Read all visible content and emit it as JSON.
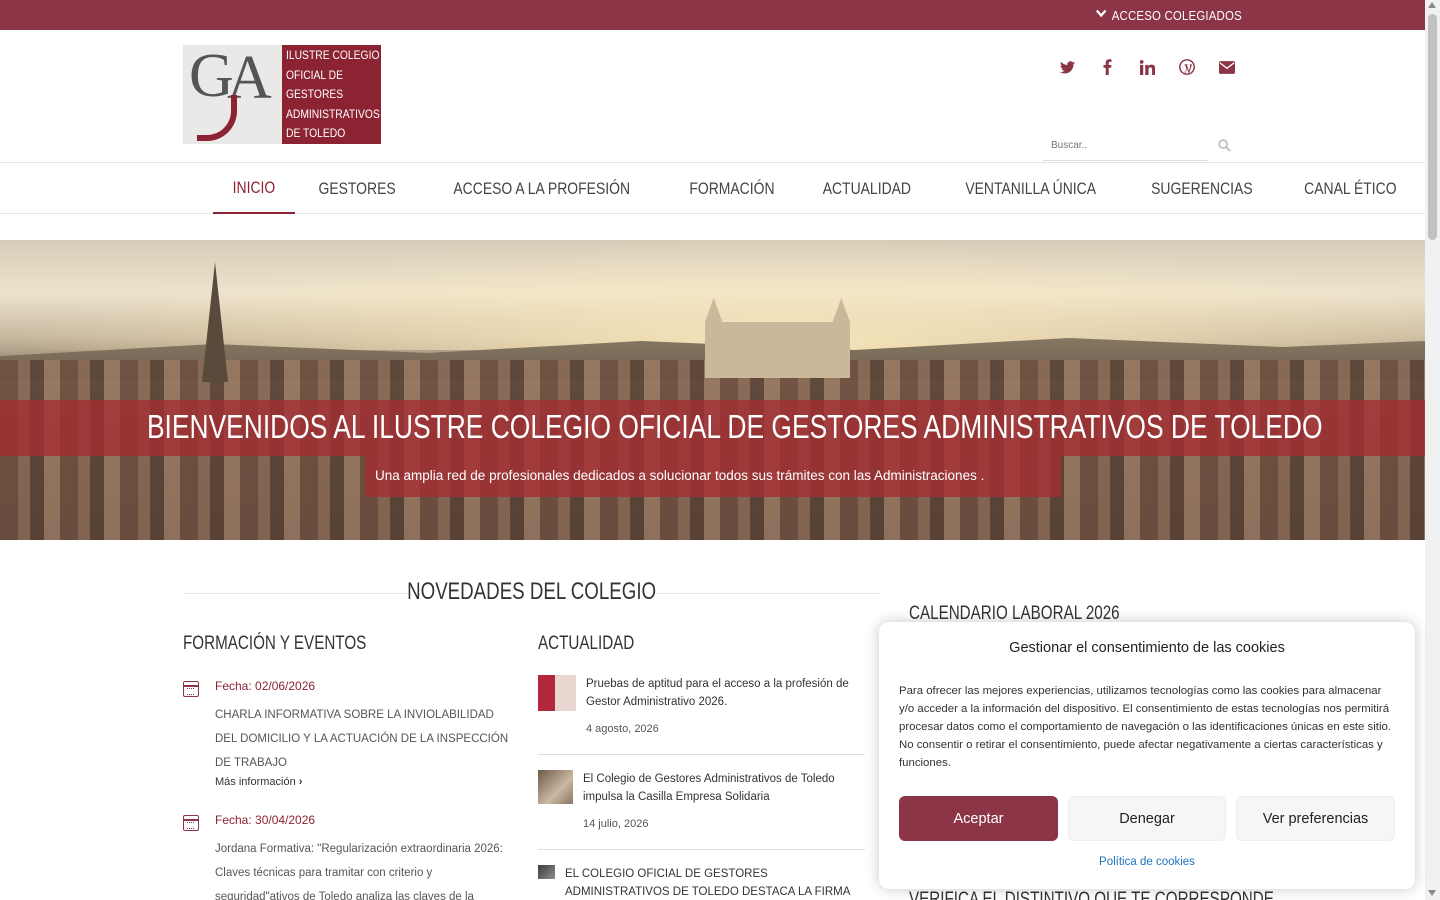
{
  "topbar": {
    "access_label": "ACCESO COLEGIADOS",
    "access_icon": "chevron-down-icon",
    "color": "#8b3547"
  },
  "logo": {
    "initials": "GA",
    "lines": [
      "ILUSTRE COLEGIO",
      "OFICIAL DE",
      "GESTORES",
      "ADMINISTRATIVOS",
      "DE TOLEDO"
    ],
    "color": "#8b2332"
  },
  "social": [
    "twitter-icon",
    "facebook-icon",
    "linkedin-icon",
    "wordpress-icon",
    "envelope-icon"
  ],
  "search": {
    "placeholder": "Buscar..",
    "icon": "search-icon"
  },
  "nav": {
    "items": [
      "INICIO",
      "GESTORES",
      "ACCESO A LA PROFESIÓN",
      "FORMACIÓN",
      "ACTUALIDAD",
      "VENTANILLA ÚNICA",
      "SUGERENCIAS",
      "CANAL ÉTICO"
    ],
    "active": "INICIO"
  },
  "hero": {
    "title": "BIENVENIDOS AL ILUSTRE COLEGIO OFICIAL DE GESTORES ADMINISTRATIVOS DE TOLEDO",
    "subtitle": "Una amplia red de profesionales dedicados a solucionar todos sus trámites con las Administraciones ."
  },
  "main": {
    "section_title": "NOVEDADES DEL COLEGIO",
    "events_heading": "FORMACIÓN Y EVENTOS",
    "events": [
      {
        "date": "Fecha: 02/06/2026",
        "body": "CHARLA INFORMATIVA SOBRE LA INVIOLABILIDAD DEL DOMICILIO Y LA ACTUACIÓN DE LA INSPECCIÓN DE TRABAJO",
        "more": "Más información"
      },
      {
        "date": "Fecha: 30/04/2026",
        "body": "Jordana Formativa: \"Regularización extraordinaria 2026: Claves técnicas para tramitar con criterio y seguridad\"ativos de Toledo analiza las claves de la",
        "more": ""
      }
    ],
    "news_heading": "ACTUALIDAD",
    "news": [
      {
        "title": "Pruebas de aptitud para el acceso a la profesión de Gestor Administrativo 2026.",
        "date": "4 agosto, 2026"
      },
      {
        "title": "El Colegio de Gestores Administrativos de Toledo impulsa la Casilla Empresa Solidaria",
        "date": "14 julio, 2026"
      },
      {
        "title": "EL COLEGIO OFICIAL DE GESTORES ADMINISTRATIVOS DE TOLEDO DESTACA LA FIRMA DEL ACUERDO PARA LA",
        "date": ""
      }
    ]
  },
  "sidebar": {
    "calendar_heading": "CALENDARIO LABORAL 2026",
    "next_heading": "VERIFICA EL DISTINTIVO QUE TE CORRESPONDE"
  },
  "cookie": {
    "title": "Gestionar el consentimiento de las cookies",
    "body": "Para ofrecer las mejores experiencias, utilizamos tecnologías como las cookies para almacenar y/o acceder a la información del dispositivo. El consentimiento de estas tecnologías nos permitirá procesar datos como el comportamiento de navegación o las identificaciones únicas en este sitio. No consentir o retirar el consentimiento, puede afectar negativamente a ciertas características y funciones.",
    "accept": "Aceptar",
    "deny": "Denegar",
    "preferences": "Ver preferencias",
    "policy": "Política de cookies",
    "accent": "#8b3547"
  }
}
